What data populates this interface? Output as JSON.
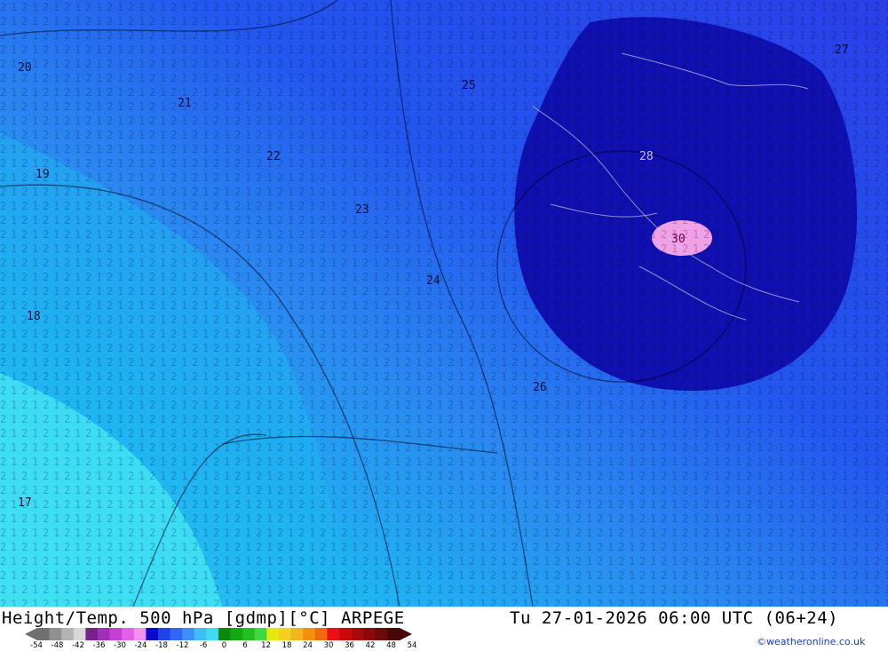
{
  "map": {
    "title": "Height/Temp. 500 hPa [gdmp][°C] ARPEGE",
    "valid_time": "Tu 27-01-2026 06:00 UTC (06+24)",
    "credit": "©weatheronline.co.uk",
    "contour_labels": [
      "17",
      "18",
      "19",
      "20",
      "21",
      "22",
      "23",
      "24",
      "25",
      "26",
      "27",
      "28",
      "30"
    ],
    "center_label": "30",
    "colors": {
      "cyan_light": "#3fe0f4",
      "cyan": "#1fb4f2",
      "blue_light": "#2a86f0",
      "blue": "#2256ee",
      "blue_dark": "#2a3ee8",
      "navy": "#1010b0",
      "pink": "#f2a0e6"
    }
  },
  "legend": {
    "ticks": [
      "-54",
      "-48",
      "-42",
      "-36",
      "-30",
      "-24",
      "-18",
      "-12",
      "-6",
      "0",
      "6",
      "12",
      "18",
      "24",
      "30",
      "36",
      "42",
      "48",
      "54"
    ],
    "colors": [
      "#707070",
      "#909090",
      "#b4b4b4",
      "#d8d8d8",
      "#7a1f8f",
      "#a030b8",
      "#c640d4",
      "#e060e8",
      "#f090f0",
      "#0a0ac8",
      "#1e44e6",
      "#2e6af0",
      "#3c90f4",
      "#40bcf6",
      "#40dcf4",
      "#0a8a0a",
      "#14a814",
      "#20c020",
      "#40d840",
      "#e8e810",
      "#f4d020",
      "#f4b420",
      "#f49010",
      "#f06a10",
      "#e81010",
      "#c80a0a",
      "#a80a0a",
      "#8a0a0a",
      "#6a0a0a",
      "#4a0606"
    ]
  }
}
